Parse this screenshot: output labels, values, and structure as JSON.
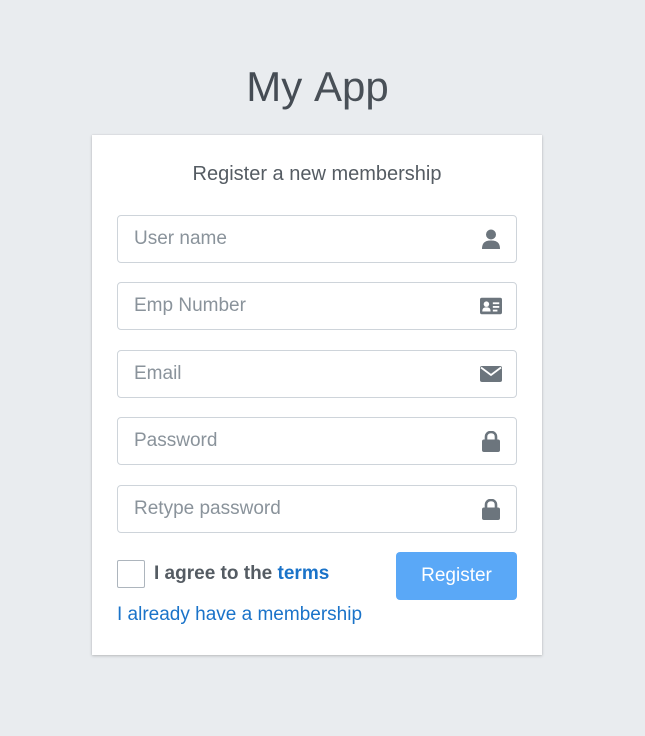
{
  "logo": {
    "bold": "My",
    "light": "App"
  },
  "register": {
    "message": "Register a new membership",
    "fields": [
      {
        "placeholder": "User name",
        "icon": "user-icon"
      },
      {
        "placeholder": "Emp Number",
        "icon": "id-card-icon"
      },
      {
        "placeholder": "Email",
        "icon": "envelope-icon"
      },
      {
        "placeholder": "Password",
        "icon": "lock-icon"
      },
      {
        "placeholder": "Retype password",
        "icon": "lock-icon"
      }
    ],
    "agree_text": "I agree to the",
    "terms_label": "terms",
    "button_label": "Register",
    "login_link": "I already have a membership"
  },
  "colors": {
    "background": "#e9ecef",
    "accent": "#5aa8f7",
    "link": "#1a73c9",
    "icon": "#6c757d"
  }
}
